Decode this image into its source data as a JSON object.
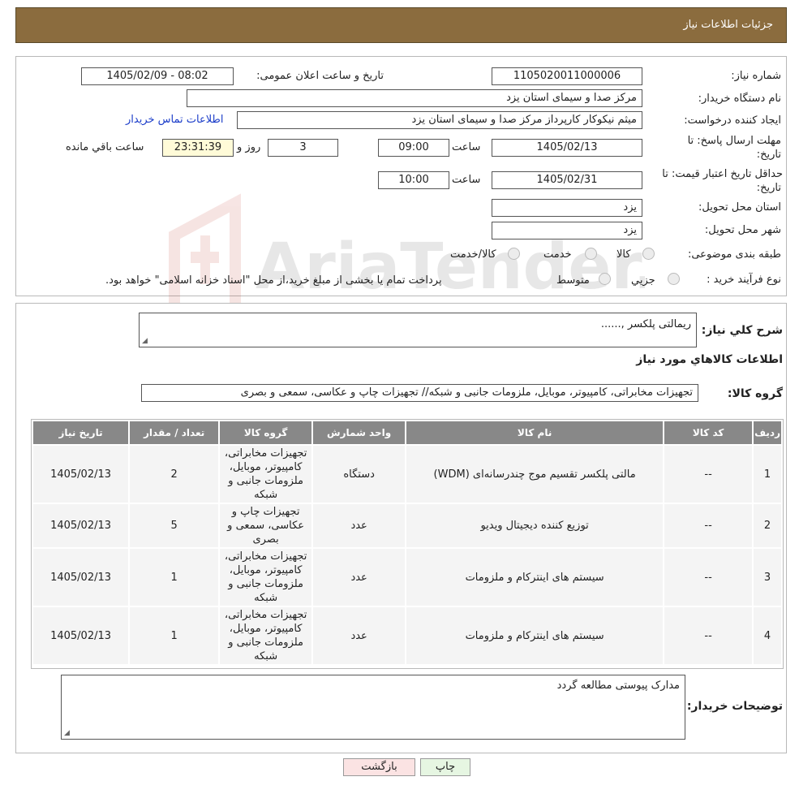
{
  "header": {
    "title": "جزئیات اطلاعات نیاز"
  },
  "form": {
    "need_number_label": "شماره نیاز:",
    "need_number": "1105020011000006",
    "announce_label": "تاریخ و ساعت اعلان عمومی:",
    "announce_value": "1405/02/09 - 08:02",
    "buyer_org_label": "نام دستگاه خریدار:",
    "buyer_org": "مرکز صدا و سیمای استان یزد",
    "creator_label": "ایجاد کننده درخواست:",
    "creator": "میثم  نیکوکار کارپرداز مرکز صدا و سیمای استان یزد",
    "contact_link": "اطلاعات تماس خریدار",
    "deadline_label_1": "مهلت ارسال پاسخ: تا",
    "deadline_label_2": "تاریخ:",
    "deadline_date": "1405/02/13",
    "time_label": "ساعت",
    "deadline_time": "09:00",
    "days_value": "3",
    "days_label": "روز و",
    "remaining_time": "23:31:39",
    "remaining_label": "ساعت باقي مانده",
    "validity_label_1": "حداقل تاریخ اعتبار قیمت: تا",
    "validity_label_2": "تاریخ:",
    "validity_date": "1405/02/31",
    "validity_time": "10:00",
    "province_label": "استان محل تحویل:",
    "province": "یزد",
    "city_label": "شهر محل تحویل:",
    "city": "یزد",
    "category_label": "طبقه بندی موضوعی:",
    "category_options": [
      "کالا",
      "خدمت",
      "کالا/خدمت"
    ],
    "process_label": "نوع فرآیند خرید :",
    "process_options": [
      "جزیي",
      "متوسط"
    ],
    "process_note": "پرداخت تمام یا بخشی از مبلغ خرید،از محل \"اسناد خزانه اسلامی\" خواهد بود."
  },
  "summary": {
    "label": "شرح کلي نیاز:",
    "value": "ریمالتی پلکسر ,......",
    "goods_title": "اطلاعات کالاهاي مورد نیاز",
    "group_label": "گروه کالا:",
    "group_value": "تجهیزات مخابراتی، کامپیوتر، موبایل، ملزومات جانبی و شبکه// تجهیزات چاپ و عکاسی، سمعی و بصری"
  },
  "table": {
    "headers": [
      "ردیف",
      "کد کالا",
      "نام کالا",
      "واحد شمارش",
      "گروه کالا",
      "تعداد / مقدار",
      "تاریخ نیاز"
    ],
    "rows": [
      [
        "1",
        "--",
        "مالتی پلکسر تقسیم موج چندرسانه‌ای (WDM)",
        "دستگاه",
        "تجهیزات مخابراتی، کامپیوتر، موبایل، ملزومات جانبی و شبکه",
        "2",
        "1405/02/13"
      ],
      [
        "2",
        "--",
        "توزیع کننده دیجیتال ویدیو",
        "عدد",
        "تجهیزات چاپ و عکاسی، سمعی و بصری",
        "5",
        "1405/02/13"
      ],
      [
        "3",
        "--",
        "سیستم های اینترکام و ملزومات",
        "عدد",
        "تجهیزات مخابراتی، کامپیوتر، موبایل، ملزومات جانبی و شبکه",
        "1",
        "1405/02/13"
      ],
      [
        "4",
        "--",
        "سیستم های اینترکام و ملزومات",
        "عدد",
        "تجهیزات مخابراتی، کامپیوتر، موبایل، ملزومات جانبی و شبکه",
        "1",
        "1405/02/13"
      ]
    ]
  },
  "notes": {
    "label": "توضیحات خریدار:",
    "value": "مدارک پیوستی مطالعه گردد"
  },
  "buttons": {
    "print": "چاپ",
    "back": "بازگشت"
  },
  "watermark": {
    "text": "AriaTender.neT"
  }
}
